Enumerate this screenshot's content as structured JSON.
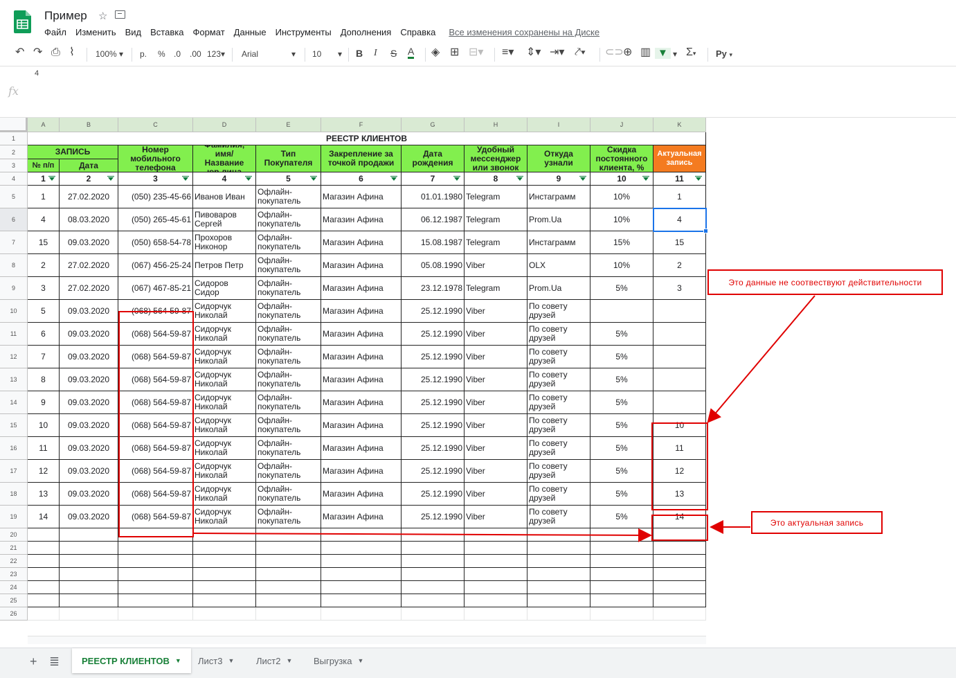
{
  "doc": {
    "title": "Пример",
    "menu": [
      "Файл",
      "Изменить",
      "Вид",
      "Вставка",
      "Формат",
      "Данные",
      "Инструменты",
      "Дополнения",
      "Справка"
    ],
    "saved_status": "Все изменения сохранены на Диске"
  },
  "toolbar": {
    "zoom": "100%",
    "currency": "р.",
    "percent": "%",
    "dec_minus": ".0",
    "dec_plus": ".00",
    "more_formats": "123",
    "font": "Arial",
    "font_size": "10",
    "bold": "B",
    "italic": "I",
    "strike": "S",
    "text_color": "A",
    "sum": "Σ",
    "input_tools": "Ру"
  },
  "formula_bar": {
    "name_box": "4",
    "fx": "fx"
  },
  "columns": [
    "A",
    "B",
    "C",
    "D",
    "E",
    "F",
    "G",
    "H",
    "I",
    "J",
    "K"
  ],
  "rows": [
    "1",
    "2",
    "3",
    "4",
    "5",
    "6",
    "7",
    "8",
    "9",
    "10",
    "11",
    "12",
    "13",
    "14",
    "15",
    "16",
    "17",
    "18",
    "19",
    "20",
    "21",
    "22",
    "23",
    "24",
    "25",
    "26"
  ],
  "sheet_title": "РЕЕСТР КЛИЕНТОВ",
  "headers": {
    "zapis": "ЗАПИСЬ",
    "np": "№ п/п",
    "date": "Дата",
    "phone": "Номер мобильного телефона",
    "name": "Фамилия, имя/ Название юр.лица",
    "type": "Тип Покупателя",
    "store": "Закрепление за точкой продажи",
    "birth": "Дата рождения",
    "messenger": "Удобный мессенджер или звонок",
    "source": "Откуда узнали",
    "discount": "Скидка постоянного клиента, %",
    "actual": "Актуальная запись"
  },
  "col_numbers": [
    "1",
    "2",
    "3",
    "4",
    "5",
    "6",
    "7",
    "8",
    "9",
    "10",
    "11"
  ],
  "data_rows": [
    [
      "1",
      "27.02.2020",
      "(050) 235-45-66",
      "Иванов Иван",
      "Офлайн-покупатель",
      "Магазин Афина",
      "01.01.1980",
      "Telegram",
      "Инстаграмм",
      "10%",
      "1"
    ],
    [
      "4",
      "08.03.2020",
      "(050) 265-45-61",
      "Пивоваров Сергей",
      "Офлайн-покупатель",
      "Магазин Афина",
      "06.12.1987",
      "Telegram",
      "Prom.Ua",
      "10%",
      "4"
    ],
    [
      "15",
      "09.03.2020",
      "(050) 658-54-78",
      "Прохоров Никонор",
      "Офлайн-покупатель",
      "Магазин Афина",
      "15.08.1987",
      "Telegram",
      "Инстаграмм",
      "15%",
      "15"
    ],
    [
      "2",
      "27.02.2020",
      "(067) 456-25-24",
      "Петров Петр",
      "Офлайн-покупатель",
      "Магазин Афина",
      "05.08.1990",
      "Viber",
      "OLX",
      "10%",
      "2"
    ],
    [
      "3",
      "27.02.2020",
      "(067) 467-85-21",
      "Сидоров Сидор",
      "Офлайн-покупатель",
      "Магазин Афина",
      "23.12.1978",
      "Telegram",
      "Prom.Ua",
      "5%",
      "3"
    ],
    [
      "5",
      "09.03.2020",
      "(068) 564-59-87",
      "Сидорчук Николай",
      "Офлайн-покупатель",
      "Магазин Афина",
      "25.12.1990",
      "Viber",
      "По совету друзей",
      "",
      ""
    ],
    [
      "6",
      "09.03.2020",
      "(068) 564-59-87",
      "Сидорчук Николай",
      "Офлайн-покупатель",
      "Магазин Афина",
      "25.12.1990",
      "Viber",
      "По совету друзей",
      "5%",
      ""
    ],
    [
      "7",
      "09.03.2020",
      "(068) 564-59-87",
      "Сидорчук Николай",
      "Офлайн-покупатель",
      "Магазин Афина",
      "25.12.1990",
      "Viber",
      "По совету друзей",
      "5%",
      ""
    ],
    [
      "8",
      "09.03.2020",
      "(068) 564-59-87",
      "Сидорчук Николай",
      "Офлайн-покупатель",
      "Магазин Афина",
      "25.12.1990",
      "Viber",
      "По совету друзей",
      "5%",
      ""
    ],
    [
      "9",
      "09.03.2020",
      "(068) 564-59-87",
      "Сидорчук Николай",
      "Офлайн-покупатель",
      "Магазин Афина",
      "25.12.1990",
      "Viber",
      "По совету друзей",
      "5%",
      ""
    ],
    [
      "10",
      "09.03.2020",
      "(068) 564-59-87",
      "Сидорчук Николай",
      "Офлайн-покупатель",
      "Магазин Афина",
      "25.12.1990",
      "Viber",
      "По совету друзей",
      "5%",
      "10"
    ],
    [
      "11",
      "09.03.2020",
      "(068) 564-59-87",
      "Сидорчук Николай",
      "Офлайн-покупатель",
      "Магазин Афина",
      "25.12.1990",
      "Viber",
      "По совету друзей",
      "5%",
      "11"
    ],
    [
      "12",
      "09.03.2020",
      "(068) 564-59-87",
      "Сидорчук Николай",
      "Офлайн-покупатель",
      "Магазин Афина",
      "25.12.1990",
      "Viber",
      "По совету друзей",
      "5%",
      "12"
    ],
    [
      "13",
      "09.03.2020",
      "(068) 564-59-87",
      "Сидорчук Николай",
      "Офлайн-покупатель",
      "Магазин Афина",
      "25.12.1990",
      "Viber",
      "По совету друзей",
      "5%",
      "13"
    ],
    [
      "14",
      "09.03.2020",
      "(068) 564-59-87",
      "Сидорчук Николай",
      "Офлайн-покупатель",
      "Магазин Афина",
      "25.12.1990",
      "Viber",
      "По совету друзей",
      "5%",
      "14"
    ]
  ],
  "annotations": {
    "wrong": "Это данные не соотвествуют действительности",
    "actual": "Это актуальная запись"
  },
  "sheets": [
    {
      "name": "РЕЕСТР КЛИЕНТОВ",
      "active": true
    },
    {
      "name": "Лист3",
      "active": false
    },
    {
      "name": "Лист2",
      "active": false
    },
    {
      "name": "Выгрузка",
      "active": false
    }
  ],
  "icons": [
    "sheets-logo-icon",
    "star-icon",
    "folder-icon",
    "undo-icon",
    "redo-icon",
    "print-icon",
    "paint-format-icon",
    "fill-color-icon",
    "borders-icon",
    "merge-icon",
    "align-icon",
    "valign-icon",
    "wrap-icon",
    "rotate-icon",
    "link-icon",
    "comment-icon",
    "chart-icon",
    "filter-icon",
    "add-sheet-icon",
    "all-sheets-icon"
  ],
  "colors": {
    "header_green": "#82ef4e",
    "actual_orange": "#f47b20",
    "annotation_red": "#e00000",
    "active_tab": "#188038"
  }
}
